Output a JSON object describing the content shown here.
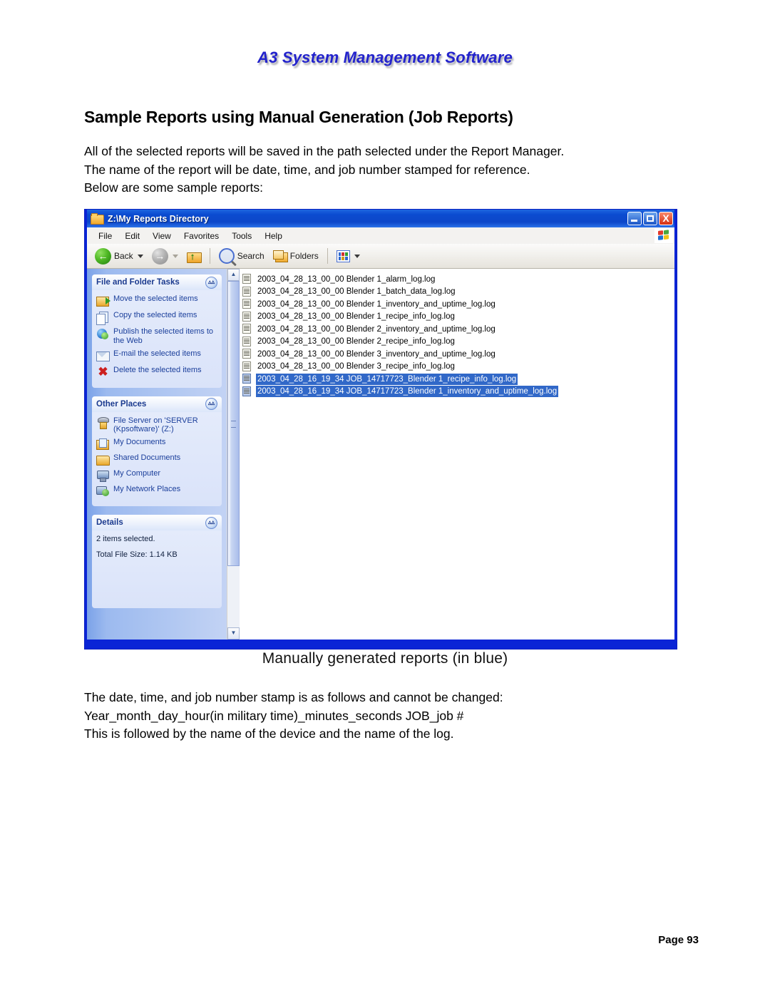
{
  "document": {
    "brand_header": "A3 System Management Software",
    "title": "Sample Reports using Manual Generation (Job Reports)",
    "intro_lines": [
      "All of the selected reports will be saved in the path selected under the Report Manager.",
      "The name of the report will be date, time, and job number stamped for reference.",
      "Below are some sample reports:"
    ],
    "caption": "Manually generated reports (in blue)",
    "lower_lines": [
      "The date, time, and job number stamp is as follows and cannot be changed:",
      "Year_month_day_hour(in military time)_minutes_seconds JOB_job #",
      "This is followed by the name of the device and the name of the log."
    ],
    "page_number": "Page 93",
    "brand_color": "#2222cc"
  },
  "explorer": {
    "title": "Z:\\My Reports Directory",
    "window_buttons": {
      "minimize": "_",
      "maximize": "❑",
      "close": "X"
    },
    "menu": [
      "File",
      "Edit",
      "View",
      "Favorites",
      "Tools",
      "Help"
    ],
    "toolbar": {
      "back_label": "Back",
      "forward_label": "",
      "search_label": "Search",
      "folders_label": "Folders",
      "views_label": ""
    },
    "task_panel": {
      "title": "File and Folder Tasks",
      "items": [
        {
          "label": "Move the selected items",
          "icon": "move-icon"
        },
        {
          "label": "Copy the selected items",
          "icon": "copy-icon"
        },
        {
          "label": "Publish the selected items to the Web",
          "icon": "publish-web-icon"
        },
        {
          "label": "E-mail the selected items",
          "icon": "email-icon"
        },
        {
          "label": "Delete the selected items",
          "icon": "delete-icon"
        }
      ]
    },
    "other_places": {
      "title": "Other Places",
      "items": [
        {
          "label": "File Server on 'SERVER (Kpsoftware)' (Z:)",
          "icon": "network-drive-icon"
        },
        {
          "label": "My Documents",
          "icon": "my-documents-icon"
        },
        {
          "label": "Shared Documents",
          "icon": "shared-folder-icon"
        },
        {
          "label": "My Computer",
          "icon": "my-computer-icon"
        },
        {
          "label": "My Network Places",
          "icon": "network-places-icon"
        }
      ]
    },
    "details": {
      "title": "Details",
      "selected_text": "2 items selected.",
      "size_text": "Total File Size: 1.14 KB"
    },
    "files": [
      {
        "name": "2003_04_28_13_00_00 Blender 1_alarm_log.log",
        "selected": false
      },
      {
        "name": "2003_04_28_13_00_00 Blender 1_batch_data_log.log",
        "selected": false
      },
      {
        "name": "2003_04_28_13_00_00 Blender 1_inventory_and_uptime_log.log",
        "selected": false
      },
      {
        "name": "2003_04_28_13_00_00 Blender 1_recipe_info_log.log",
        "selected": false
      },
      {
        "name": "2003_04_28_13_00_00 Blender 2_inventory_and_uptime_log.log",
        "selected": false
      },
      {
        "name": "2003_04_28_13_00_00 Blender 2_recipe_info_log.log",
        "selected": false
      },
      {
        "name": "2003_04_28_13_00_00 Blender 3_inventory_and_uptime_log.log",
        "selected": false
      },
      {
        "name": "2003_04_28_13_00_00 Blender 3_recipe_info_log.log",
        "selected": false
      },
      {
        "name": "2003_04_28_16_19_34 JOB_14717723_Blender 1_recipe_info_log.log",
        "selected": true
      },
      {
        "name": "2003_04_28_16_19_34 JOB_14717723_Blender 1_inventory_and_uptime_log.log",
        "selected": true
      }
    ],
    "selection_color": "#3168c8",
    "titlebar_color": "#0b4bd0"
  }
}
